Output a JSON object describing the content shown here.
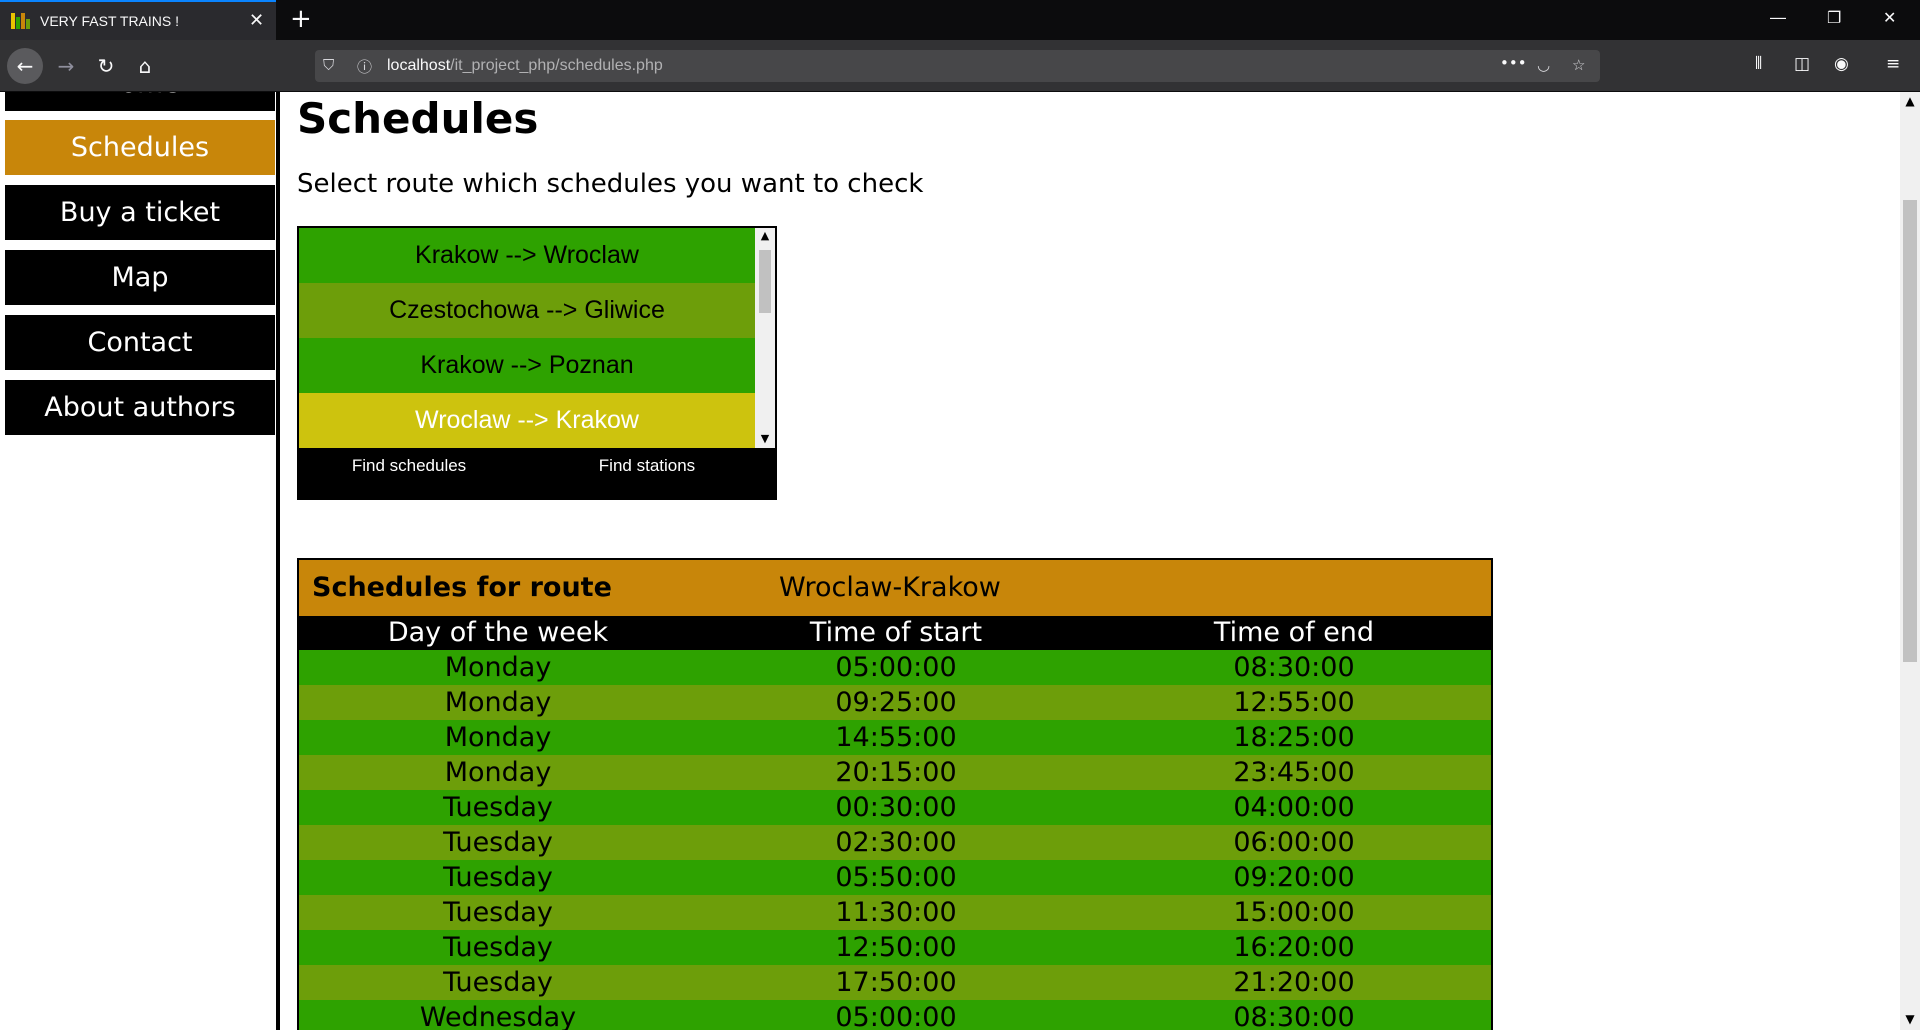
{
  "browser": {
    "tab_title": "VERY FAST TRAINS !",
    "close_glyph": "✕",
    "new_tab_glyph": "+",
    "url_host": "localhost",
    "url_path": "/it_project_php/schedules.php",
    "more_glyph": "•••"
  },
  "sidebar": {
    "items": [
      {
        "label": "Home"
      },
      {
        "label": "Schedules"
      },
      {
        "label": "Buy a ticket"
      },
      {
        "label": "Map"
      },
      {
        "label": "Contact"
      },
      {
        "label": "About authors"
      }
    ]
  },
  "main": {
    "title": "Schedules",
    "subtitle": "Select route which schedules you want to check",
    "routes": [
      "Krakow --> Wroclaw",
      "Czestochowa --> Gliwice",
      "Krakow --> Poznan",
      "Wroclaw --> Krakow"
    ],
    "selected_route": "Wroclaw --> Krakow",
    "find_schedules": "Find schedules",
    "find_stations": "Find stations"
  },
  "schedule": {
    "label": "Schedules for route",
    "route": "Wroclaw-Krakow",
    "headers": [
      "Day of the week",
      "Time of start",
      "Time of end"
    ],
    "rows": [
      [
        "Monday",
        "05:00:00",
        "08:30:00"
      ],
      [
        "Monday",
        "09:25:00",
        "12:55:00"
      ],
      [
        "Monday",
        "14:55:00",
        "18:25:00"
      ],
      [
        "Monday",
        "20:15:00",
        "23:45:00"
      ],
      [
        "Tuesday",
        "00:30:00",
        "04:00:00"
      ],
      [
        "Tuesday",
        "02:30:00",
        "06:00:00"
      ],
      [
        "Tuesday",
        "05:50:00",
        "09:20:00"
      ],
      [
        "Tuesday",
        "11:30:00",
        "15:00:00"
      ],
      [
        "Tuesday",
        "12:50:00",
        "16:20:00"
      ],
      [
        "Tuesday",
        "17:50:00",
        "21:20:00"
      ],
      [
        "Wednesday",
        "05:00:00",
        "08:30:00"
      ]
    ]
  },
  "colors": {
    "accent": "#c8860a",
    "row_green": "#2ea200",
    "row_olive": "#6d9e0a",
    "selected": "#cdc30e"
  }
}
